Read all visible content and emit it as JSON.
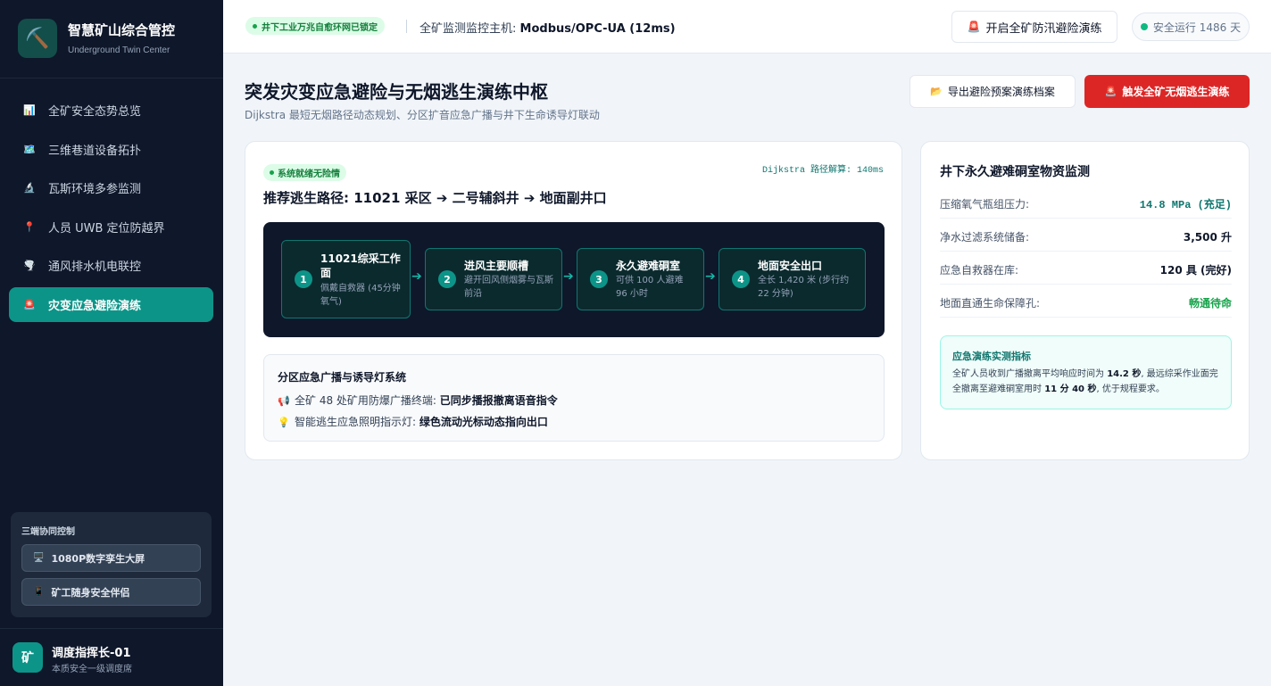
{
  "brand": {
    "title": "智慧矿山综合管控",
    "subtitle": "Underground Twin Center",
    "logo_icon": "⛏️"
  },
  "nav": [
    {
      "icon": "📊",
      "label": "全矿安全态势总览"
    },
    {
      "icon": "🗺️",
      "label": "三维巷道设备拓扑"
    },
    {
      "icon": "🔬",
      "label": "瓦斯环境多参监测"
    },
    {
      "icon": "📍",
      "label": "人员 UWB 定位防越界"
    },
    {
      "icon": "🌪️",
      "label": "通风排水机电联控"
    },
    {
      "icon": "🚨",
      "label": "灾变应急避险演练"
    }
  ],
  "collab": {
    "title": "三端协同控制",
    "buttons": [
      {
        "icon": "🖥️",
        "label": "1080P数字孪生大屏"
      },
      {
        "icon": "📱",
        "label": "矿工随身安全伴侣"
      }
    ]
  },
  "user": {
    "avatar": "矿",
    "name": "调度指挥长-01",
    "role": "本质安全一级调度席"
  },
  "topbar": {
    "network_badge": "井下工业万兆自愈环网已锁定",
    "host_label": "全矿监测监控主机: ",
    "host_value": "Modbus/OPC-UA (12ms)",
    "flood_button": "开启全矿防汛避险演练",
    "flood_icon": "🚨",
    "safe_days": "安全运行 1486 天"
  },
  "page": {
    "title": "突发灾变应急避险与无烟逃生演练中枢",
    "subtitle": "Dijkstra 最短无烟路径动态规划、分区扩音应急广播与井下生命诱导灯联动",
    "export_button": "导出避险预案演练档案",
    "export_icon": "📂",
    "trigger_button": "触发全矿无烟逃生演练",
    "trigger_icon": "🚨"
  },
  "route": {
    "status_badge": "系统就绪无险情",
    "dijkstra": "Dijkstra 路径解算: 140ms",
    "title": "推荐逃生路径: 11021 采区 ➔ 二号辅斜井 ➔ 地面副井口",
    "steps": [
      {
        "num": "1",
        "title": "11021综采工作面",
        "desc": "佩戴自救器 (45分钟氧气)"
      },
      {
        "num": "2",
        "title": "进风主要顺槽",
        "desc": "避开回风侧烟雾与瓦斯前沿"
      },
      {
        "num": "3",
        "title": "永久避难硐室",
        "desc": "可供 100 人避难 96 小时"
      },
      {
        "num": "4",
        "title": "地面安全出口",
        "desc": "全长 1,420 米 (步行约 22 分钟)"
      }
    ],
    "arrow": "➔"
  },
  "broadcast": {
    "title": "分区应急广播与诱导灯系统",
    "line1_icon": "📢",
    "line1_label": "全矿 48 处矿用防爆广播终端: ",
    "line1_value": "已同步播报撤离语音指令",
    "line2_icon": "💡",
    "line2_label": "智能逃生应急照明指示灯: ",
    "line2_value": "绿色流动光标动态指向出口"
  },
  "shelter": {
    "title": "井下永久避难硐室物资监测",
    "rows": [
      {
        "key": "压缩氧气瓶组压力:",
        "value": "14.8 MPa (充足)"
      },
      {
        "key": "净水过滤系统储备:",
        "value": "3,500 升"
      },
      {
        "key": "应急自救器在库:",
        "value": "120 具 (完好)"
      },
      {
        "key": "地面直通生命保障孔:",
        "value": "畅通待命"
      }
    ],
    "metric_title": "应急演练实测指标",
    "metric_t1": "全矿人员收到广播撤离平均响应时间为 ",
    "metric_v1": "14.2 秒",
    "metric_t2": ", 最远综采作业面完全撤离至避难硐室用时 ",
    "metric_v2": "11 分 40 秒",
    "metric_t3": ", 优于规程要求。"
  }
}
